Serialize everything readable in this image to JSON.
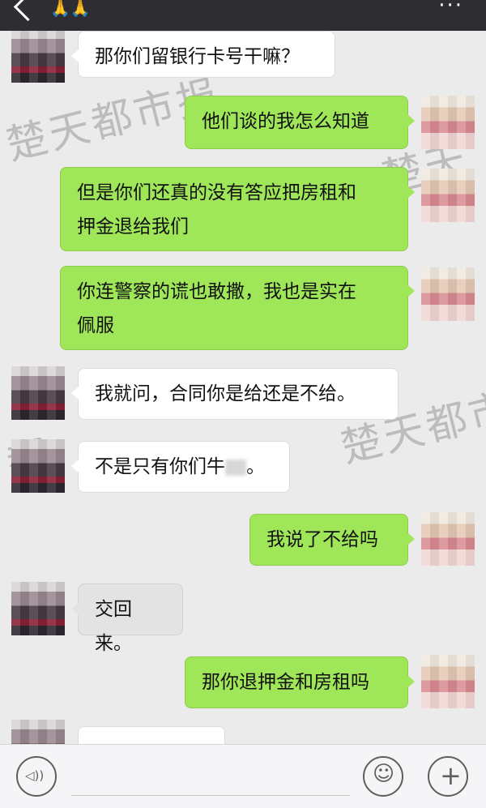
{
  "header": {
    "back_icon": "chevron-left-icon",
    "title_emoji": "🙏🙏",
    "more_icon": "more-dots-icon"
  },
  "watermark": {
    "text": "楚天都市报",
    "top_left": "楚天都市报",
    "mid_right": "楚天",
    "lower_left": "都",
    "lower_right": "楚天都市"
  },
  "messages": [
    {
      "side": "in",
      "text": "那你们留银行卡号干嘛？"
    },
    {
      "side": "out",
      "text": "他们谈的我怎么知道"
    },
    {
      "side": "out",
      "line1": "但是你们还真的没有答应把房租和",
      "line2": "押金退给我们"
    },
    {
      "side": "out",
      "line1": "你连警察的谎也敢撒，我也是实在",
      "line2": "佩服"
    },
    {
      "side": "in",
      "text": "我就问，合同你是给还是不给。"
    },
    {
      "side": "in",
      "text": "不是只有你们牛",
      "tail": "。"
    },
    {
      "side": "out",
      "text": "我说了不给吗"
    },
    {
      "side": "in",
      "text": "交回来。"
    },
    {
      "side": "out",
      "text": "那你退押金和房租吗"
    }
  ],
  "toolbar": {
    "voice_icon": "voice-icon",
    "emoji_icon": "emoji-icon",
    "plus_icon": "plus-icon",
    "voice_glyph": "◁))",
    "emoji_glyph": "☺",
    "plus_glyph": "+"
  }
}
